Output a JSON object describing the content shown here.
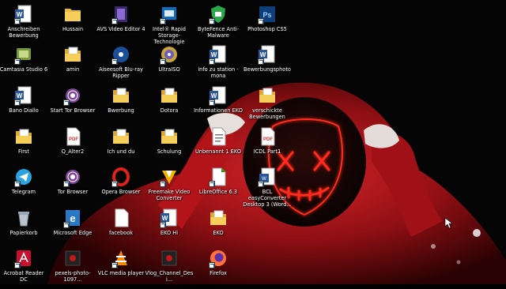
{
  "colors": {
    "accent_red": "#ff2a1a",
    "hoodie": "#c0171b"
  },
  "desktop": {
    "columns": [
      [
        {
          "label": "Anschreiben Bewerbung",
          "icon": "word-icon"
        },
        {
          "label": "Camtasia Studio 6",
          "icon": "camtasia-icon"
        },
        {
          "label": "Bano Diallo",
          "icon": "word-icon"
        },
        {
          "label": "First",
          "icon": "folder-doc-icon"
        },
        {
          "label": "Telegram",
          "icon": "telegram-icon"
        },
        {
          "label": "Papierkorb",
          "icon": "recycle-bin-icon"
        },
        {
          "label": "Acrobat Reader DC",
          "icon": "acrobat-icon"
        }
      ],
      [
        {
          "label": "Hussain",
          "icon": "folder-icon"
        },
        {
          "label": "amin",
          "icon": "folder-doc-icon"
        },
        {
          "label": "Start Tor Browser",
          "icon": "tor-icon"
        },
        {
          "label": "Q_Alter2",
          "icon": "pdf-icon"
        },
        {
          "label": "Tor Browser",
          "icon": "tor-icon"
        },
        {
          "label": "Microsoft Edge",
          "icon": "edge-icon"
        },
        {
          "label": "pexels-photo-1097...",
          "icon": "image-icon"
        }
      ],
      [
        {
          "label": "AVS Video Editor 4",
          "icon": "film-icon"
        },
        {
          "label": "Aiseesoft Blu-ray Ripper",
          "icon": "bluray-icon"
        },
        {
          "label": "Bwerbung",
          "icon": "folder-doc-icon"
        },
        {
          "label": "Ich und du",
          "icon": "folder-doc-icon"
        },
        {
          "label": "Opera Browser",
          "icon": "opera-icon"
        },
        {
          "label": "facebook",
          "icon": "blank-file-icon"
        },
        {
          "label": "VLC media player",
          "icon": "vlc-icon"
        }
      ],
      [
        {
          "label": "Intel® Rapid Storage-Technologie",
          "icon": "intel-icon"
        },
        {
          "label": "UltraISO",
          "icon": "disc-icon"
        },
        {
          "label": "Dotora",
          "icon": "folder-doc-icon"
        },
        {
          "label": "Schulung",
          "icon": "folder-doc-icon"
        },
        {
          "label": "Freemake Video Converter",
          "icon": "freemake-icon"
        },
        {
          "label": "EKO Hi",
          "icon": "word-icon"
        },
        {
          "label": "Vlog_Channel_Desi...",
          "icon": "image-icon"
        }
      ],
      [
        {
          "label": "ByteFence Anti-Malware",
          "icon": "bytefence-icon"
        },
        {
          "label": "info zu station - mona",
          "icon": "word-icon"
        },
        {
          "label": "Informationen EKO",
          "icon": "word-icon"
        },
        {
          "label": "Unbenannt 1 EKO",
          "icon": "text-doc-icon"
        },
        {
          "label": "LibreOffice 6.3",
          "icon": "libreoffice-icon"
        },
        {
          "label": "EKO",
          "icon": "folder-doc-icon"
        },
        {
          "label": "Firefox",
          "icon": "firefox-icon"
        }
      ],
      [
        {
          "label": "Photoshop CS5",
          "icon": "photoshop-icon"
        },
        {
          "label": "Bewerbungsphoto",
          "icon": "word-icon"
        },
        {
          "label": "verschickte Bewerbungen",
          "icon": "folder-doc-icon"
        },
        {
          "label": "ICDL Part1",
          "icon": "pdf-icon"
        },
        {
          "label": "BCL easyConverter Desktop 3 (Word...",
          "icon": "bcl-icon"
        }
      ]
    ]
  }
}
